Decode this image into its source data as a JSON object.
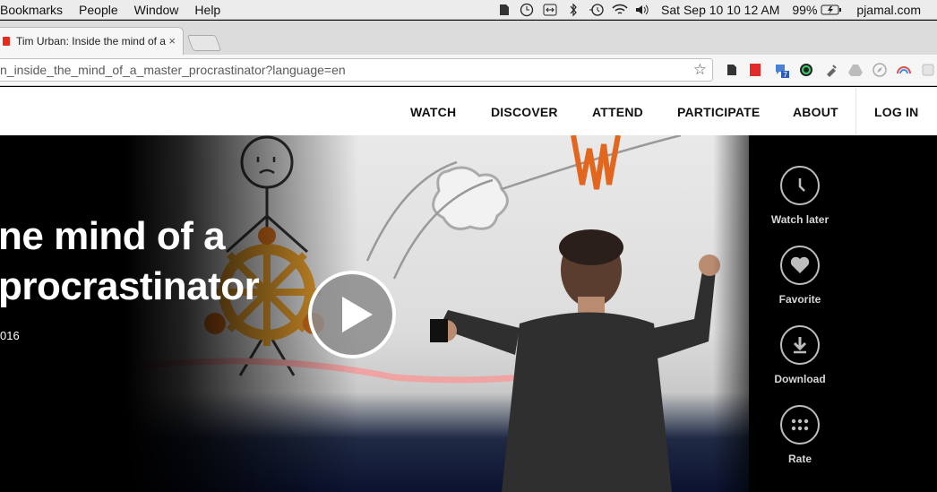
{
  "menubar": {
    "menus": [
      "Bookmarks",
      "People",
      "Window",
      "Help"
    ],
    "clock": "Sat Sep 10  10 12 AM",
    "battery": "99%",
    "user": "pjamal.com"
  },
  "tab": {
    "title": "Tim Urban: Inside the mind of a",
    "close": "×"
  },
  "address_bar": {
    "url": "n_inside_the_mind_of_a_master_procrastinator?language=en",
    "bookmark_icon": "☆"
  },
  "extensions": {
    "badge": "7"
  },
  "nav": {
    "items": [
      "WATCH",
      "DISCOVER",
      "ATTEND",
      "PARTICIPATE",
      "ABOUT"
    ],
    "login": "LOG IN"
  },
  "talk": {
    "title_line1": "ne mind of a",
    "title_line2": "procrastinator",
    "date": "016"
  },
  "actions": {
    "watch_later": "Watch later",
    "favorite": "Favorite",
    "download": "Download",
    "rate": "Rate"
  },
  "colors": {
    "ted_red": "#e62b1e",
    "hero_bg": "#000000",
    "action_label": "#d6d6d6"
  }
}
